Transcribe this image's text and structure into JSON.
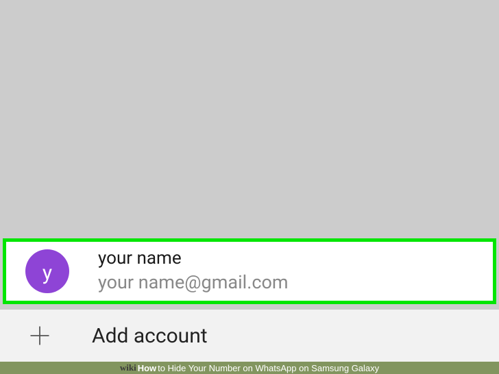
{
  "account": {
    "avatar_letter": "y",
    "name": "your name",
    "email": "your name@gmail.com",
    "avatar_color": "#8e44d6"
  },
  "add_account": {
    "label": "Add account"
  },
  "watermark": {
    "wiki": "wiki",
    "how": "How",
    "title": " to Hide Your Number on WhatsApp on Samsung Galaxy"
  },
  "highlight_color": "#00e600"
}
